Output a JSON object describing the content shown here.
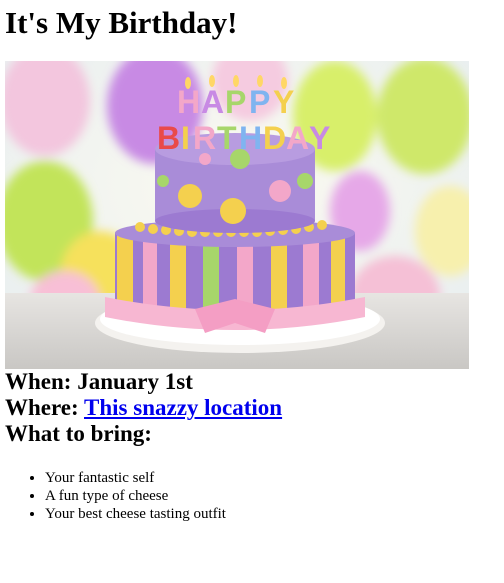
{
  "page": {
    "title": "It's My Birthday!",
    "hero_image": {
      "name": "birthday-cake-photo",
      "cake_text": "HAPPY BIRTHDAY",
      "colors": {
        "purple": "#9c7ad1",
        "yellow": "#f4d04e",
        "pink": "#f3a7c9",
        "green": "#a7d66a",
        "balloon_purple": "#c87de6",
        "balloon_green": "#c2e45a",
        "balloon_yellow": "#f6e15b"
      }
    },
    "when": {
      "label": "When:",
      "value": "January 1st"
    },
    "where": {
      "label": "Where:",
      "link_text": "This snazzy location"
    },
    "bring": {
      "heading": "What to bring:",
      "items": [
        "Your fantastic self",
        "A fun type of cheese",
        "Your best cheese tasting outfit"
      ]
    }
  }
}
